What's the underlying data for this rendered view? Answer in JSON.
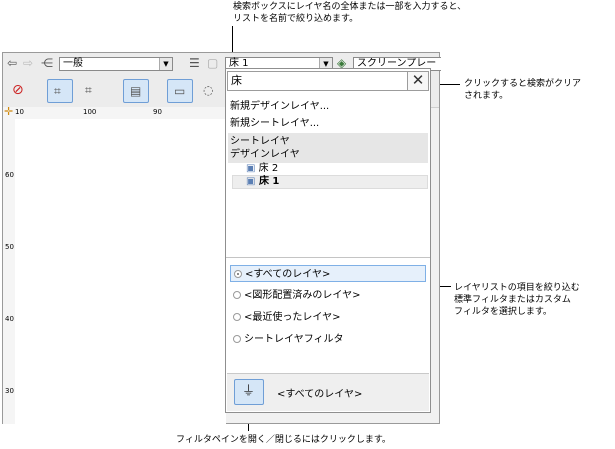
{
  "annotations": {
    "search": "検索ボックスにレイヤ名の全体または一部を入力すると、\nリストを名前で絞り込めます。",
    "clear": "クリックすると検索がクリア\nされます。",
    "filter_list": "レイヤリストの項目を絞り込む\n標準フィルタまたはカスタム\nフィルタを選択します。",
    "filter_pane": "フィルタペインを開く／閉じるにはクリックします。"
  },
  "toolbar": {
    "class_combo": "一般",
    "layer_combo": "床 1",
    "screen_plane": "スクリーンプレー"
  },
  "rulers": {
    "h": [
      "10",
      "100",
      "90"
    ],
    "v": [
      "60",
      "50",
      "40",
      "30"
    ]
  },
  "popup": {
    "search_value": "床",
    "clear_glyph": "✕",
    "new_design_layer": "新規デザインレイヤ...",
    "new_sheet_layer": "新規シートレイヤ...",
    "sheet_layer": "シートレイヤ",
    "design_layer": "デザインレイヤ",
    "layers": [
      {
        "name": "床 2",
        "bold": false
      },
      {
        "name": "床 1",
        "bold": true
      }
    ],
    "filters": [
      {
        "label": "<すべてのレイヤ>",
        "selected": true
      },
      {
        "label": "<図形配置済みのレイヤ>",
        "selected": false
      },
      {
        "label": "<最近使ったレイヤ>",
        "selected": false
      },
      {
        "label": "シートレイヤフィルタ",
        "selected": false
      }
    ],
    "current_filter": "<すべてのレイヤ>"
  }
}
